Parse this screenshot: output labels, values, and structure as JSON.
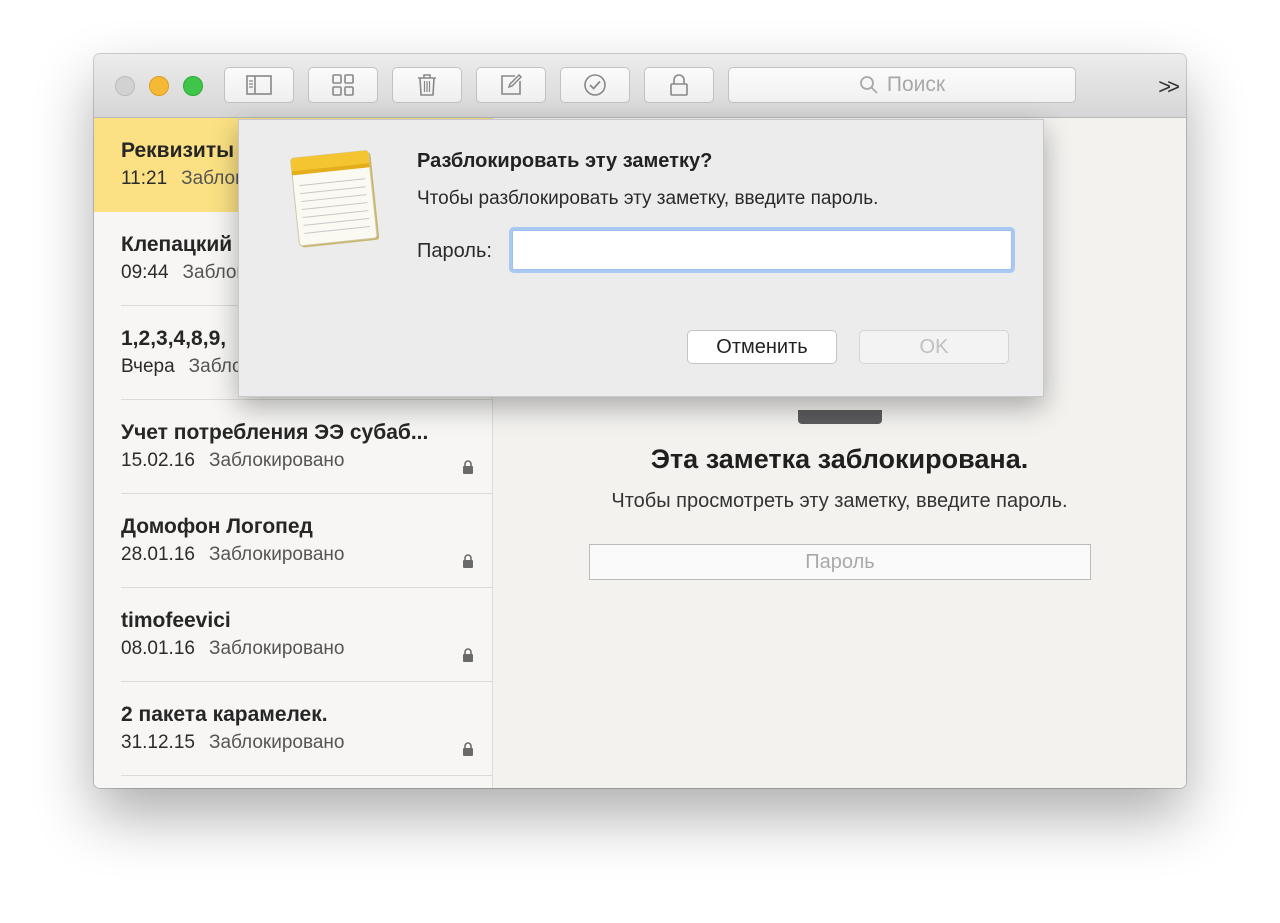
{
  "toolbar": {
    "buttons": [
      {
        "icon": "sidebar-toggle-icon"
      },
      {
        "icon": "grid-icon"
      },
      {
        "icon": "trash-icon"
      },
      {
        "icon": "compose-icon"
      },
      {
        "icon": "checklist-icon"
      },
      {
        "icon": "lock-icon"
      }
    ],
    "search_placeholder": "Поиск",
    "overflow_label": ">>"
  },
  "notes": [
    {
      "title": "Реквизиты",
      "date": "11:21",
      "status": "Заблокировано",
      "selected": true
    },
    {
      "title": "Клепацкий",
      "date": "09:44",
      "status": "Заблокировано"
    },
    {
      "title": "1,2,3,4,8,9,",
      "date": "Вчера",
      "status": "Заблокировано"
    },
    {
      "title": "Учет потребления ЭЭ субаб...",
      "date": "15.02.16",
      "status": "Заблокировано"
    },
    {
      "title": "Домофон Логопед",
      "date": "28.01.16",
      "status": "Заблокировано"
    },
    {
      "title": "timofeevici",
      "date": "08.01.16",
      "status": "Заблокировано"
    },
    {
      "title": "2 пакета карамелек.",
      "date": "31.12.15",
      "status": "Заблокировано"
    }
  ],
  "locked_view": {
    "title": "Эта заметка заблокирована.",
    "message": "Чтобы просмотреть эту заметку, введите пароль.",
    "password_placeholder": "Пароль"
  },
  "dialog": {
    "title": "Разблокировать эту заметку?",
    "message": "Чтобы разблокировать эту заметку, введите пароль.",
    "password_label": "Пароль:",
    "password_value": "",
    "cancel_label": "Отменить",
    "ok_label": "OK"
  },
  "colors": {
    "selected_note_bg": "#fbe183",
    "focus_ring": "#a9c9f2",
    "traffic_close": "#d2d2d2",
    "traffic_minimize": "#f6b936",
    "traffic_zoom": "#3fc54a"
  }
}
